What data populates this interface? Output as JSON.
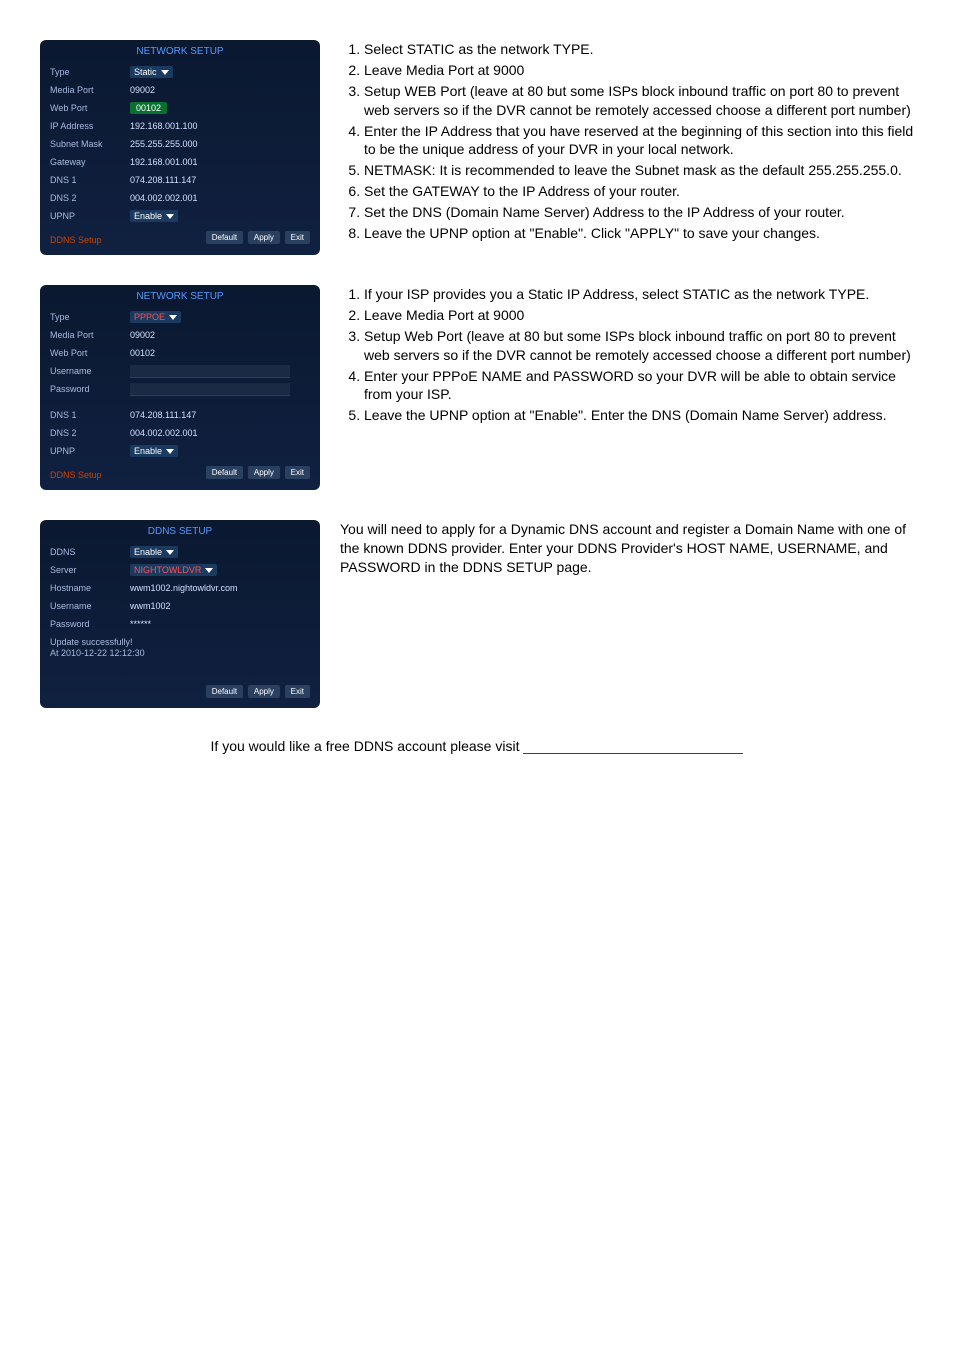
{
  "panel1": {
    "title": "NETWORK SETUP",
    "rows": [
      {
        "label": "Type",
        "value": "Static"
      },
      {
        "label": "Media Port",
        "value": "09002"
      },
      {
        "label": "Web Port",
        "value": "00102"
      },
      {
        "label": "IP Address",
        "value": "192.168.001.100"
      },
      {
        "label": "Subnet Mask",
        "value": "255.255.255.000"
      },
      {
        "label": "Gateway",
        "value": "192.168.001.001"
      },
      {
        "label": "DNS 1",
        "value": "074.208.111.147"
      },
      {
        "label": "DNS 2",
        "value": "004.002.002.001"
      },
      {
        "label": "UPNP",
        "value": "Enable"
      }
    ],
    "ddns_link": "DDNS Setup",
    "buttons": [
      "Default",
      "Apply",
      "Exit"
    ]
  },
  "list1": [
    "Select STATIC as the network TYPE.",
    "Leave Media Port at 9000",
    "Setup WEB Port (leave at 80 but some ISPs block inbound traffic on port 80 to prevent web servers so if the DVR cannot be remotely accessed choose a different port number)",
    "Enter the IP Address that you have reserved at the beginning of this section into this field to be the unique address of your DVR in your local network.",
    "NETMASK: It is recommended to leave the Subnet mask as the default 255.255.255.0.",
    "Set the GATEWAY to the IP Address of your router.",
    "Set the DNS (Domain Name Server) Address to the IP Address of your router.",
    "Leave the UPNP option at \"Enable\".   Click \"APPLY\" to save your changes."
  ],
  "panel2": {
    "title": "NETWORK SETUP",
    "rows_top": [
      {
        "label": "Type",
        "value": "PPPOE"
      },
      {
        "label": "Media Port",
        "value": "09002"
      },
      {
        "label": "Web Port",
        "value": "00102"
      },
      {
        "label": "Username",
        "value": ""
      },
      {
        "label": "Password",
        "value": ""
      }
    ],
    "rows_bottom": [
      {
        "label": "DNS 1",
        "value": "074.208.111.147"
      },
      {
        "label": "DNS 2",
        "value": "004.002.002.001"
      },
      {
        "label": "UPNP",
        "value": "Enable"
      }
    ],
    "ddns_link": "DDNS Setup",
    "buttons": [
      "Default",
      "Apply",
      "Exit"
    ]
  },
  "list2": [
    "If your ISP provides you a Static IP Address, select STATIC as the network TYPE.",
    "Leave Media Port at 9000",
    "Setup Web Port (leave at 80 but some ISPs block inbound traffic on port 80 to prevent web servers so if the DVR cannot be remotely accessed choose a different port number)",
    "Enter your PPPoE NAME and PASSWORD so your DVR will be able to obtain service from your ISP.",
    "Leave the UPNP option at \"Enable\".   Enter the DNS (Domain Name Server) address."
  ],
  "panel3": {
    "title": "DDNS SETUP",
    "rows": [
      {
        "label": "DDNS",
        "value": "Enable"
      },
      {
        "label": "Server",
        "value": "NIGHTOWLDVR"
      },
      {
        "label": "Hostname",
        "value": "wwm1002.nightowldvr.com"
      },
      {
        "label": "Username",
        "value": "wwm1002"
      },
      {
        "label": "Password",
        "value": "******"
      }
    ],
    "status": "Update successfully!\nAt 2010-12-22 12:12:30",
    "buttons": [
      "Default",
      "Apply",
      "Exit"
    ]
  },
  "para3": "You will need to apply for a Dynamic DNS account and register a Domain Name with one of the known DDNS provider.   Enter your DDNS Provider's HOST NAME, USERNAME, and PASSWORD in the DDNS SETUP page.",
  "footer": "If you would like a free DDNS account please visit"
}
